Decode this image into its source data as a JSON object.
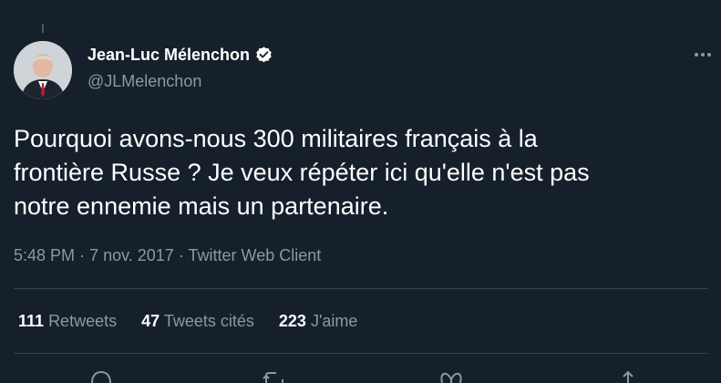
{
  "tweet": {
    "author": {
      "display_name": "Jean-Luc Mélenchon",
      "handle": "@JLMelenchon",
      "verified": true,
      "avatar_icon": "profile-photo"
    },
    "text": "Pourquoi avons-nous 300 militaires français à la\nfrontière Russe ? Je veux répéter ici qu'elle n'est pas\nnotre ennemie mais un partenaire.",
    "time": "5:48 PM",
    "date": "7 nov. 2017",
    "source": "Twitter Web Client",
    "separator": "·",
    "stats": {
      "retweets": {
        "count": "111",
        "label": "Retweets"
      },
      "quotes": {
        "count": "47",
        "label": "Tweets cités"
      },
      "likes": {
        "count": "223",
        "label": "J'aime"
      }
    }
  },
  "icons": {
    "more": "more-horizontal-icon",
    "reply": "reply-icon",
    "retweet": "retweet-icon",
    "like": "heart-icon",
    "share": "share-icon"
  },
  "colors": {
    "background": "#15202b",
    "text_primary": "#ffffff",
    "text_secondary": "#8b98a5",
    "divider": "#38444d",
    "verified_badge": "#ffffff"
  }
}
